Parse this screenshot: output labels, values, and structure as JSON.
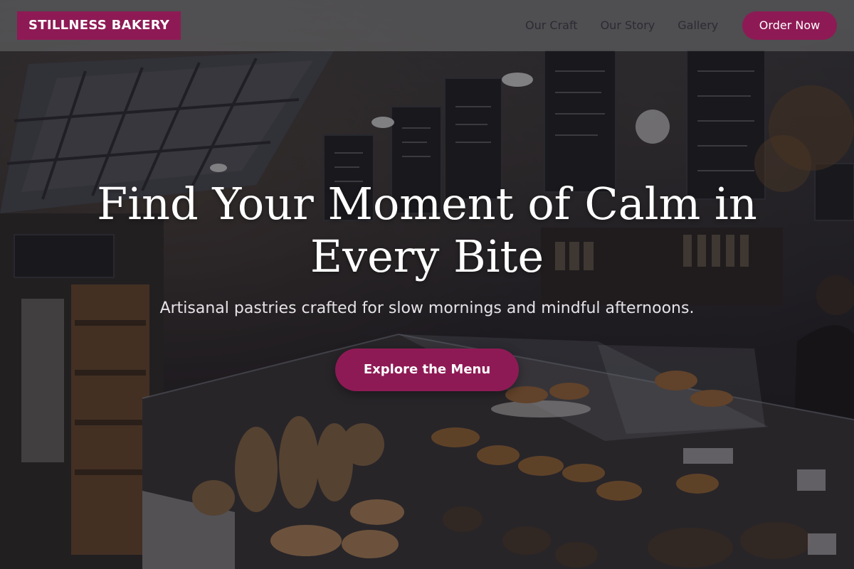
{
  "brand": {
    "name": "STILLNESS BAKERY"
  },
  "nav": {
    "items": [
      {
        "label": "Our Craft"
      },
      {
        "label": "Our Story"
      },
      {
        "label": "Gallery"
      }
    ],
    "order_label": "Order Now"
  },
  "hero": {
    "headline": "Find Your Moment of Calm in Every Bite",
    "subheadline": "Artisanal pastries crafted for slow mornings and mindful afternoons.",
    "cta_label": "Explore the Menu",
    "background_image": "bakery-interior-photo"
  },
  "colors": {
    "accent": "#8e1a55",
    "text_light": "#ffffff",
    "header_bg": "rgba(110,110,112,0.55)",
    "overlay": "rgba(20,18,24,0.45)"
  }
}
